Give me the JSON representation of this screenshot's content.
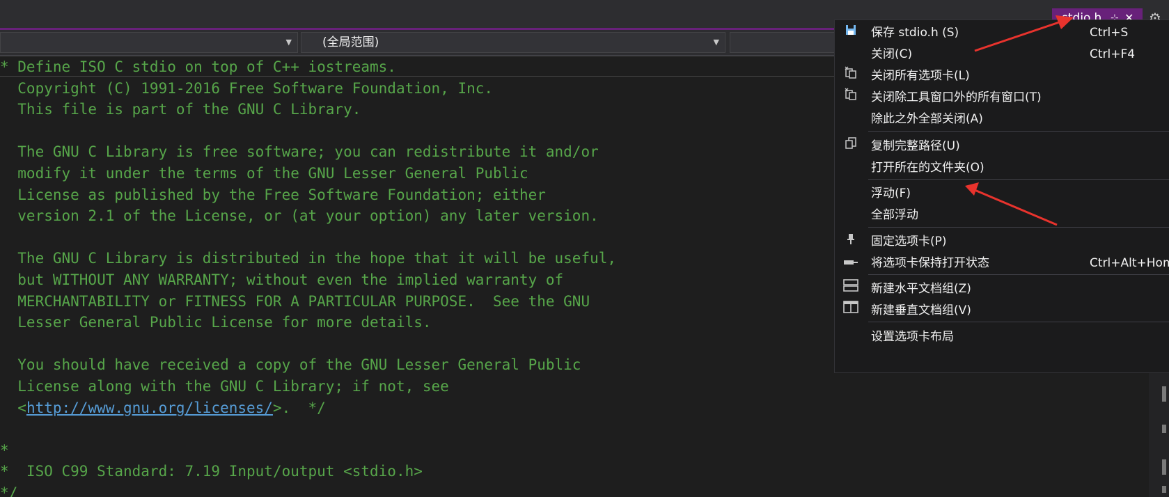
{
  "tab": {
    "title": "stdio.h",
    "pin_glyph": "⊹",
    "close_glyph": "✕"
  },
  "navbar": {
    "project_combo": "",
    "scope_combo": "(全局范围)",
    "member_combo": ""
  },
  "editor": {
    "lines": [
      "* Define ISO C stdio on top of C++ iostreams.",
      "  Copyright (C) 1991-2016 Free Software Foundation, Inc.",
      "  This file is part of the GNU C Library.",
      "",
      "  The GNU C Library is free software; you can redistribute it and/or",
      "  modify it under the terms of the GNU Lesser General Public",
      "  License as published by the Free Software Foundation; either",
      "  version 2.1 of the License, or (at your option) any later version.",
      "",
      "  The GNU C Library is distributed in the hope that it will be useful,",
      "  but WITHOUT ANY WARRANTY; without even the implied warranty of",
      "  MERCHANTABILITY or FITNESS FOR A PARTICULAR PURPOSE.  See the GNU",
      "  Lesser General Public License for more details.",
      "",
      "  You should have received a copy of the GNU Lesser General Public",
      "  License along with the GNU C Library; if not, see"
    ],
    "link_line": {
      "prefix": "  <",
      "link": "http://www.gnu.org/licenses/",
      "suffix": ">.  */"
    },
    "tail_lines": [
      "",
      "*",
      "*  ISO C99 Standard: 7.19 Input/output <stdio.h>",
      "*/"
    ]
  },
  "menu": {
    "items": [
      {
        "icon": "save-icon",
        "label": "保存 stdio.h (S)",
        "shortcut": "Ctrl+S"
      },
      {
        "icon": "",
        "label": "关闭(C)",
        "shortcut": "Ctrl+F4"
      },
      {
        "icon": "close-tabs-icon",
        "label": "关闭所有选项卡(L)",
        "shortcut": ""
      },
      {
        "icon": "close-tabs-icon",
        "label": "关闭除工具窗口外的所有窗口(T)",
        "shortcut": ""
      },
      {
        "icon": "",
        "label": "除此之外全部关闭(A)",
        "shortcut": ""
      },
      {
        "icon": "copy-icon",
        "label": "复制完整路径(U)",
        "shortcut": ""
      },
      {
        "icon": "",
        "label": "打开所在的文件夹(O)",
        "shortcut": ""
      },
      {
        "icon": "",
        "label": "浮动(F)",
        "shortcut": ""
      },
      {
        "icon": "",
        "label": "全部浮动",
        "shortcut": ""
      },
      {
        "icon": "pin-icon",
        "label": "固定选项卡(P)",
        "shortcut": ""
      },
      {
        "icon": "keep-open-icon",
        "label": "将选项卡保持打开状态",
        "shortcut": "Ctrl+Alt+Home"
      },
      {
        "icon": "horizontal-group-icon",
        "label": "新建水平文档组(Z)",
        "shortcut": ""
      },
      {
        "icon": "vertical-group-icon",
        "label": "新建垂直文档组(V)",
        "shortcut": ""
      },
      {
        "icon": "",
        "label": "设置选项卡布局",
        "shortcut": ""
      }
    ]
  },
  "colors": {
    "accent": "#68217a",
    "comment": "#57a64a",
    "link": "#569cd6",
    "annotation": "#e8332d"
  }
}
